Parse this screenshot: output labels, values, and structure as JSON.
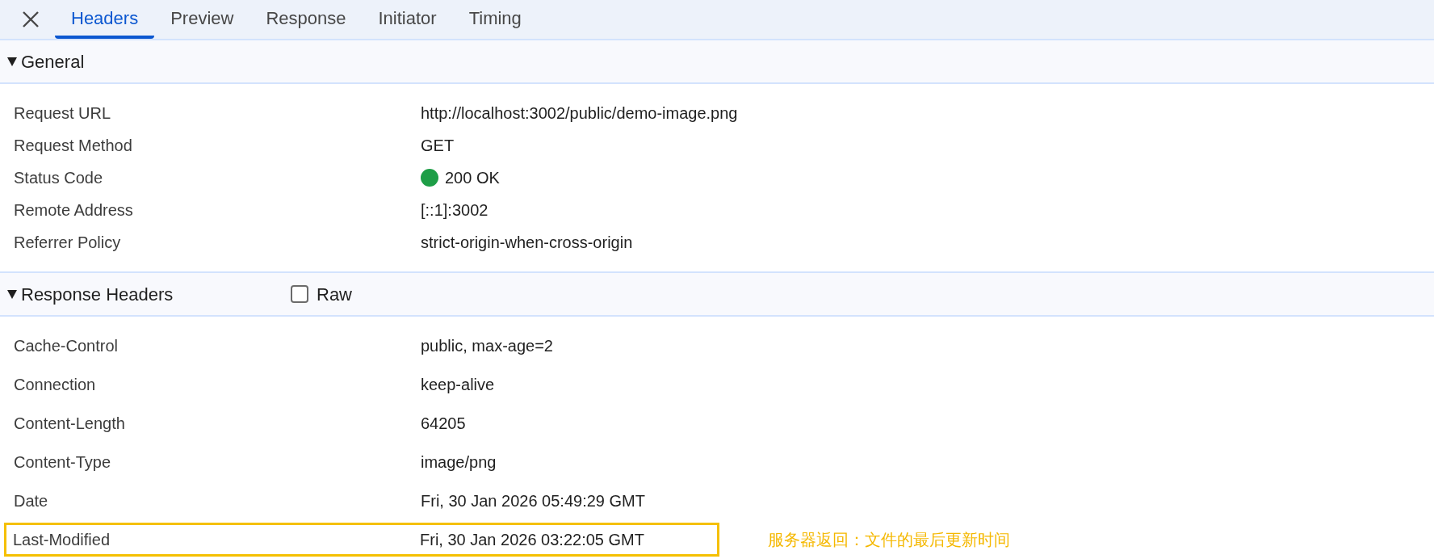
{
  "tabs": [
    {
      "label": "Headers",
      "selected": true
    },
    {
      "label": "Preview",
      "selected": false
    },
    {
      "label": "Response",
      "selected": false
    },
    {
      "label": "Initiator",
      "selected": false
    },
    {
      "label": "Timing",
      "selected": false
    }
  ],
  "sections": [
    {
      "title": "General",
      "expanded": true,
      "rows": [
        {
          "name": "Request URL",
          "value": "http://localhost:3002/public/demo-image.png",
          "highlighted": false
        },
        {
          "name": "Request Method",
          "value": "GET",
          "highlighted": false
        },
        {
          "name": "Status Code",
          "value": "200 OK",
          "color": "#1e9e47",
          "highlighted": false
        },
        {
          "name": "Remote Address",
          "value": "[::1]:3002",
          "highlighted": false
        },
        {
          "name": "Referrer Policy",
          "value": "strict-origin-when-cross-origin",
          "highlighted": false
        }
      ]
    },
    {
      "title": "Response Headers",
      "expanded": true,
      "raw": {
        "label": "Raw",
        "checked": false
      },
      "rows": [
        {
          "name": "Cache-Control",
          "value": "public, max-age=2",
          "highlighted": false
        },
        {
          "name": "Connection",
          "value": "keep-alive",
          "highlighted": false
        },
        {
          "name": "Content-Length",
          "value": "64205",
          "highlighted": false
        },
        {
          "name": "Content-Type",
          "value": "image/png",
          "highlighted": false
        },
        {
          "name": "Date",
          "value": "Fri, 30 Jan 2026 05:49:29 GMT",
          "highlighted": false
        },
        {
          "name": "Last-Modified",
          "value": "Fri, 30 Jan 2026 03:22:05 GMT",
          "highlighted": true,
          "note": "服务器返回：文件的最后更新时间"
        }
      ]
    }
  ]
}
